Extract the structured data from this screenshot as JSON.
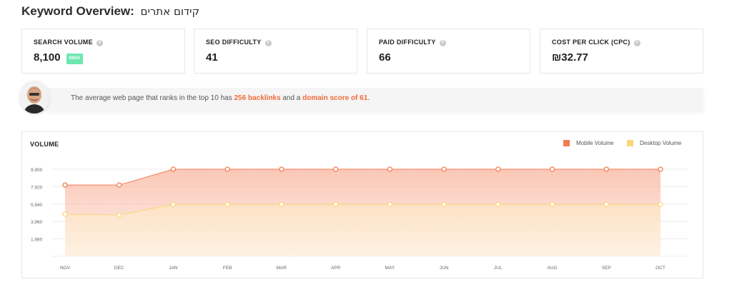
{
  "header": {
    "title": "Keyword Overview:",
    "keyword": "קידום אתרים"
  },
  "metrics": [
    {
      "label": "SEARCH VOLUME",
      "value": "8,100",
      "badge": "HIGH",
      "badge_color": "#6ee7b0"
    },
    {
      "label": "SEO DIFFICULTY",
      "value": "41"
    },
    {
      "label": "PAID DIFFICULTY",
      "value": "66"
    },
    {
      "label": "COST PER CLICK (CPC)",
      "value": "₪32.77"
    }
  ],
  "insight": {
    "prefix": "The average web page that ranks in the top 10 has ",
    "backlinks": "256 backlinks",
    "middle": " and a ",
    "domain_score": "domain score of 61",
    "suffix": "."
  },
  "chart": {
    "title": "VOLUME",
    "legend": {
      "mobile": "Mobile Volume",
      "desktop": "Desktop Volume"
    }
  },
  "colors": {
    "mobile": "#f47c54",
    "desktop": "#fcd57a",
    "highlight": "#ef6b3a"
  },
  "chart_data": {
    "type": "area",
    "categories": [
      "NOV",
      "DEC",
      "JAN",
      "FEB",
      "MAR",
      "APR",
      "MAY",
      "JUN",
      "JUL",
      "AUG",
      "SEP",
      "OCT"
    ],
    "series": [
      {
        "name": "Mobile Volume",
        "values": [
          8100,
          8100,
          9900,
          9900,
          9900,
          9900,
          9900,
          9900,
          9900,
          9900,
          9900,
          9900
        ]
      },
      {
        "name": "Desktop Volume",
        "values": [
          4800,
          4700,
          5900,
          5900,
          5900,
          5900,
          5900,
          5900,
          5900,
          5900,
          5900,
          5900
        ]
      }
    ],
    "yticks": [
      "1,980",
      "3,960",
      "5,940",
      "7,920",
      "9,900"
    ],
    "ylim": [
      0,
      9900
    ],
    "grid": true,
    "legend_position": "top-right"
  }
}
